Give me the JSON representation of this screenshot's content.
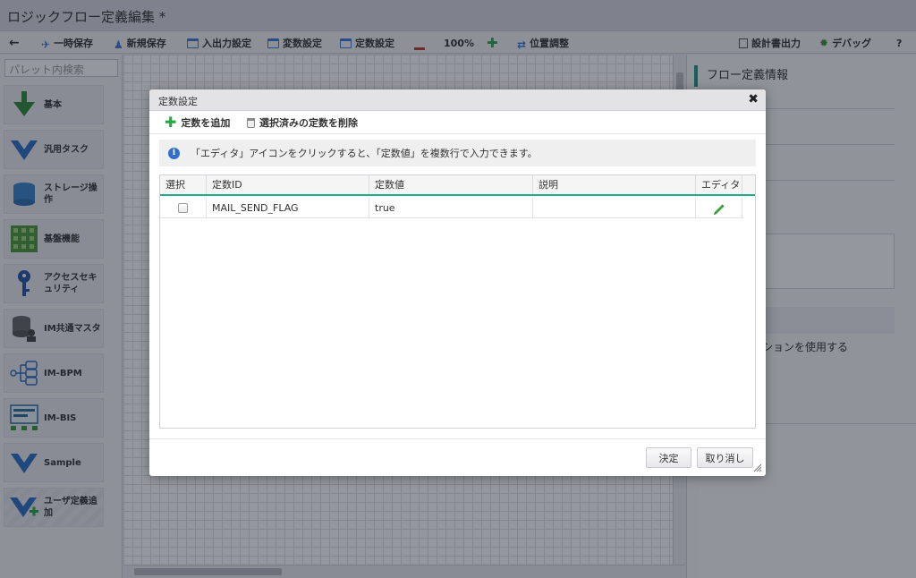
{
  "window": {
    "title": "ロジックフロー定義編集 *"
  },
  "toolbar": {
    "temp_save": "一時保存",
    "new_save": "新規保存",
    "io_settings": "入出力設定",
    "var_settings": "変数設定",
    "const_settings": "定数設定",
    "zoom": "100%",
    "position_adjust": "位置調整",
    "design_output": "設計書出力",
    "debug": "デバッグ",
    "help": "?"
  },
  "palette": {
    "search_placeholder": "パレット内検索",
    "items": [
      {
        "label": "基本",
        "icon": "down-arrow-green-icon"
      },
      {
        "label": "汎用タスク",
        "icon": "down-arrow-blue-icon"
      },
      {
        "label": "ストレージ操作",
        "icon": "storage-icon"
      },
      {
        "label": "基盤機能",
        "icon": "grid-icon"
      },
      {
        "label": "アクセスセキュリティ",
        "icon": "key-icon"
      },
      {
        "label": "IM共通マスタ",
        "icon": "database-user-icon"
      },
      {
        "label": "IM-BPM",
        "icon": "process-flow-icon"
      },
      {
        "label": "IM-BIS",
        "icon": "form-icon"
      },
      {
        "label": "Sample",
        "icon": "down-arrow-blue-icon"
      },
      {
        "label": "ユーザ定義追加",
        "icon": "add-user-defined-icon"
      }
    ]
  },
  "properties": {
    "header": "フロー定義情報",
    "option_label": "ションを使用する"
  },
  "dialog": {
    "title": "定数設定",
    "add_label": "定数を追加",
    "delete_label": "選択済みの定数を削除",
    "info_message": "「エディタ」アイコンをクリックすると、「定数値」を複数行で入力できます。",
    "columns": [
      "選択",
      "定数ID",
      "定数値",
      "説明",
      "エディタ"
    ],
    "rows": [
      {
        "checked": false,
        "id": "MAIL_SEND_FLAG",
        "value": "true",
        "description": ""
      }
    ],
    "ok_label": "決定",
    "cancel_label": "取り消し"
  },
  "colors": {
    "accent": "#1fae8c",
    "add_icon": "#27a844",
    "info_icon": "#2f6fcf"
  }
}
